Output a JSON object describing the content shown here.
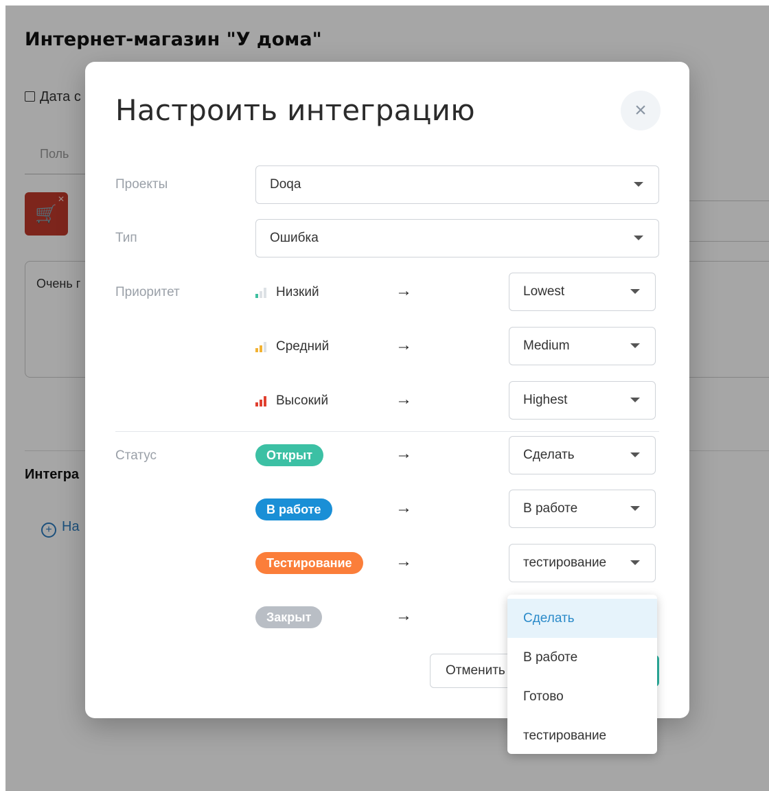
{
  "background": {
    "title": "Интернет-магазин \"У дома\"",
    "date_label": "Дата с",
    "user_placeholder": "Поль",
    "textarea_text": "Очень г",
    "integrations_label": "Интегра",
    "add_label": "На"
  },
  "modal": {
    "title": "Настроить интеграцию",
    "close_label": "×",
    "projects": {
      "label": "Проекты",
      "value": "Doqa"
    },
    "type": {
      "label": "Тип",
      "value": "Ошибка"
    },
    "priority": {
      "label": "Приоритет",
      "rows": [
        {
          "name": "Низкий",
          "color": "#3fbfa0",
          "level": 1,
          "value": "Lowest"
        },
        {
          "name": "Средний",
          "color": "#f2b233",
          "level": 2,
          "value": "Medium"
        },
        {
          "name": "Высокий",
          "color": "#e0402f",
          "level": 3,
          "value": "Highest"
        }
      ]
    },
    "status": {
      "label": "Статус",
      "rows": [
        {
          "name": "Открыт",
          "color": "#3cc0a4",
          "value": "Сделать"
        },
        {
          "name": "В работе",
          "color": "#1a8fd6",
          "value": "В работе"
        },
        {
          "name": "Тестирование",
          "color": "#fb7e3a",
          "value": "тестирование"
        },
        {
          "name": "Закрыт",
          "color": "#b9bec5",
          "value": ""
        }
      ]
    },
    "arrow": "→",
    "cancel_label": "Отменить",
    "dropdown_options": [
      "Сделать",
      "В работе",
      "Готово",
      "тестирование"
    ],
    "dropdown_active_index": 0
  }
}
